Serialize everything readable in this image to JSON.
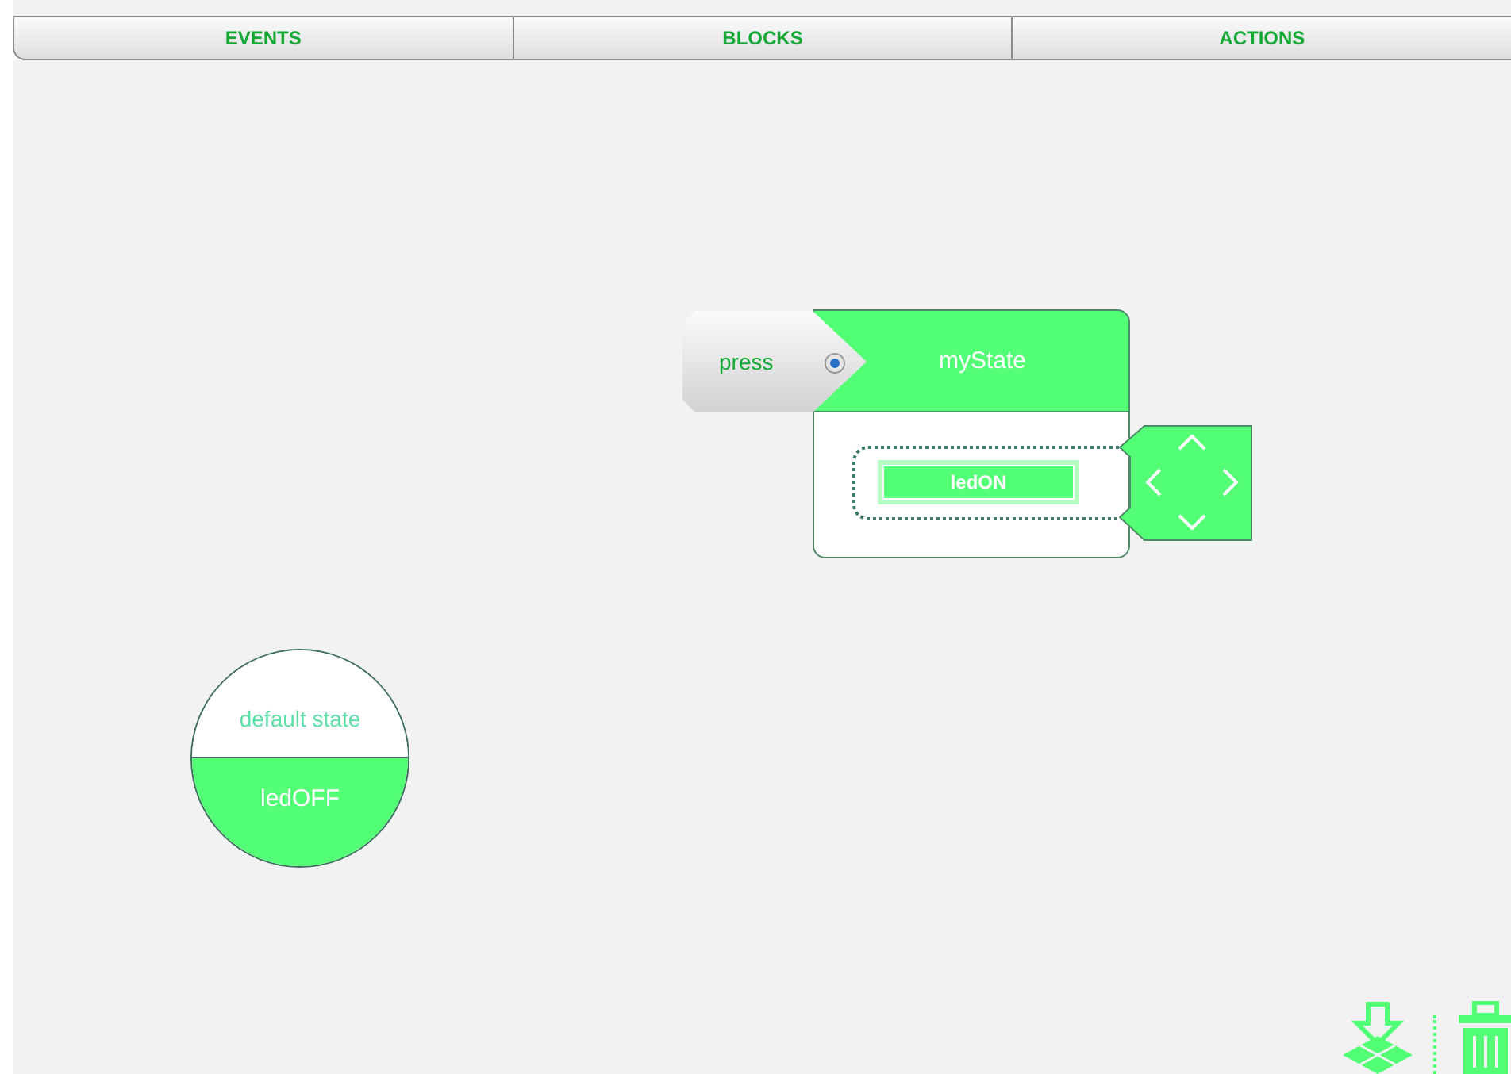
{
  "tabs": [
    {
      "label": "EVENTS"
    },
    {
      "label": "BLOCKS"
    },
    {
      "label": "ACTIONS"
    }
  ],
  "state_block": {
    "trigger": "press",
    "name": "myState",
    "action": "ledON"
  },
  "default_state": {
    "label": "default state",
    "value": "ledOFF"
  }
}
